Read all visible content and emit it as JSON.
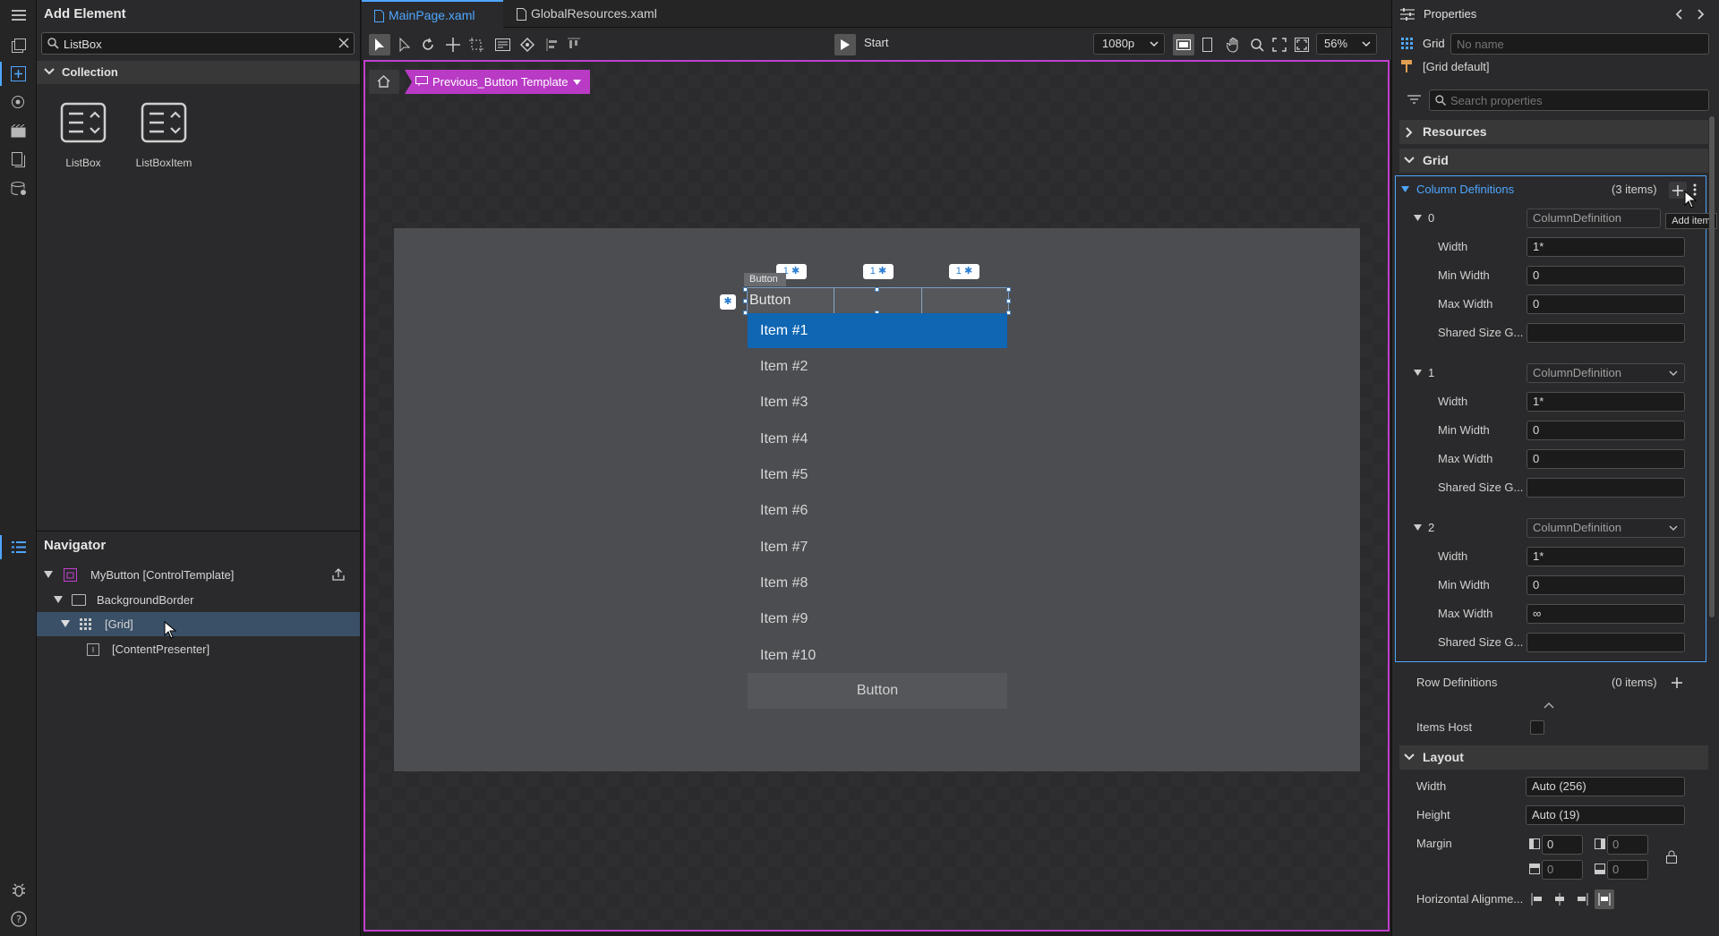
{
  "add_element": {
    "title": "Add Element",
    "search_value": "ListBox",
    "collection_header": "Collection",
    "items": [
      {
        "label": "ListBox",
        "icon": "listbox-icon"
      },
      {
        "label": "ListBoxItem",
        "icon": "listboxitem-icon"
      }
    ]
  },
  "navigator": {
    "title": "Navigator",
    "tree": [
      {
        "label": "MyButton [ControlTemplate]",
        "icon": "control-template-icon"
      },
      {
        "label": "BackgroundBorder",
        "icon": "border-icon"
      },
      {
        "label": "[Grid]",
        "icon": "grid-icon"
      },
      {
        "label": "[ContentPresenter]",
        "icon": "content-presenter-icon"
      }
    ]
  },
  "tabs": [
    {
      "label": "MainPage.xaml",
      "active": true
    },
    {
      "label": "GlobalResources.xaml",
      "active": false
    }
  ],
  "toolbar": {
    "start_label": "Start",
    "resolution": "1080p",
    "zoom": "56%"
  },
  "breadcrumb": {
    "template_label": "Previous_Button Template"
  },
  "canvas": {
    "column_badges": [
      "1 ✱",
      "1 ✱",
      "1 ✱"
    ],
    "row_badge": "✱",
    "element_tag": "Button",
    "button_text": "Button",
    "list_items": [
      "Item #1",
      "Item #2",
      "Item #3",
      "Item #4",
      "Item #5",
      "Item #6",
      "Item #7",
      "Item #8",
      "Item #9",
      "Item #10"
    ],
    "bottom_button": "Button"
  },
  "properties": {
    "title": "Properties",
    "element_type": "Grid",
    "name_placeholder": "No name",
    "style_label": "[Grid default]",
    "search_placeholder": "Search properties",
    "resources_label": "Resources",
    "grid_label": "Grid",
    "column_definitions": {
      "label": "Column Definitions",
      "count": "(3 items)",
      "tooltip": "Add item",
      "items": [
        {
          "index": "0",
          "type": "ColumnDefinition",
          "width": "1*",
          "min_width": "0",
          "max_width": "0",
          "shared_size": ""
        },
        {
          "index": "1",
          "type": "ColumnDefinition",
          "width": "1*",
          "min_width": "0",
          "max_width": "0",
          "shared_size": ""
        },
        {
          "index": "2",
          "type": "ColumnDefinition",
          "width": "1*",
          "min_width": "0",
          "max_width": "∞",
          "shared_size": ""
        }
      ]
    },
    "labels": {
      "width": "Width",
      "min_width": "Min Width",
      "max_width": "Max Width",
      "shared_size": "Shared Size G..."
    },
    "row_definitions": {
      "label": "Row Definitions",
      "count": "(0 items)"
    },
    "items_host": "Items Host",
    "layout": {
      "label": "Layout",
      "width_label": "Width",
      "width_value": "Auto (256)",
      "height_label": "Height",
      "height_value": "Auto (19)",
      "margin_label": "Margin",
      "margin": [
        "0",
        "0",
        "0",
        "0"
      ],
      "halign_label": "Horizontal Alignme..."
    }
  },
  "colors": {
    "accent": "#4ea6ff",
    "selection": "#0f66b3",
    "template_border": "#c23fcf"
  }
}
